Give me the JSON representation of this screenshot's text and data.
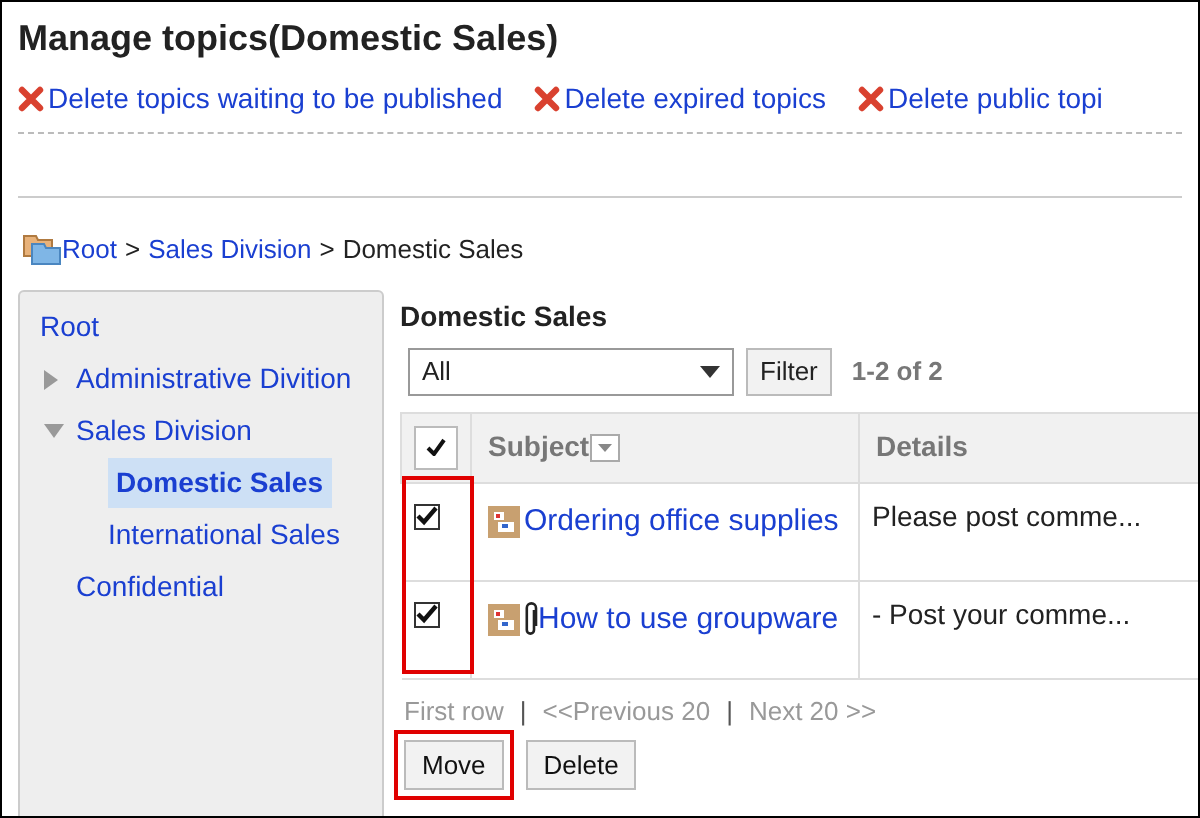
{
  "title": "Manage topics(Domestic Sales)",
  "actions": [
    {
      "label": "Delete topics waiting to be published"
    },
    {
      "label": "Delete expired topics"
    },
    {
      "label": "Delete public topi"
    }
  ],
  "breadcrumb": {
    "items": [
      {
        "label": "Root",
        "link": true
      },
      {
        "label": "Sales Division",
        "link": true
      },
      {
        "label": "Domestic Sales",
        "link": false
      }
    ],
    "separators": [
      ">",
      ">"
    ]
  },
  "tree": [
    {
      "label": "Root",
      "selected": false,
      "children": [
        {
          "label": "Administrative Divition",
          "expanded": false,
          "selected": false
        },
        {
          "label": "Sales Division",
          "expanded": true,
          "selected": false,
          "children": [
            {
              "label": "Domestic Sales",
              "selected": true
            },
            {
              "label": "International Sales",
              "selected": false
            }
          ]
        },
        {
          "label": "Confidential",
          "selected": false
        }
      ]
    }
  ],
  "folder_title": "Domestic Sales",
  "filter": {
    "value": "All",
    "button": "Filter",
    "count": "1-2 of 2"
  },
  "table": {
    "checkbox_column_highlighted": true,
    "columns": [
      "Subject",
      "Details"
    ],
    "rows": [
      {
        "checked": true,
        "subject": "Ordering office supplies",
        "attachment": false,
        "details": "Please post comme..."
      },
      {
        "checked": true,
        "subject": "How to use groupware",
        "attachment": true,
        "details": "- Post your comme..."
      }
    ]
  },
  "pagination": {
    "links": [
      {
        "label": "First row",
        "disabled": true
      },
      {
        "label": "<<Previous 20",
        "disabled": true
      },
      {
        "label": "Next 20 >>",
        "disabled": true
      }
    ],
    "separators": [
      "|",
      "|"
    ]
  },
  "buttons": [
    {
      "label": "Move",
      "highlighted": true
    },
    {
      "label": "Delete",
      "highlighted": false
    }
  ]
}
